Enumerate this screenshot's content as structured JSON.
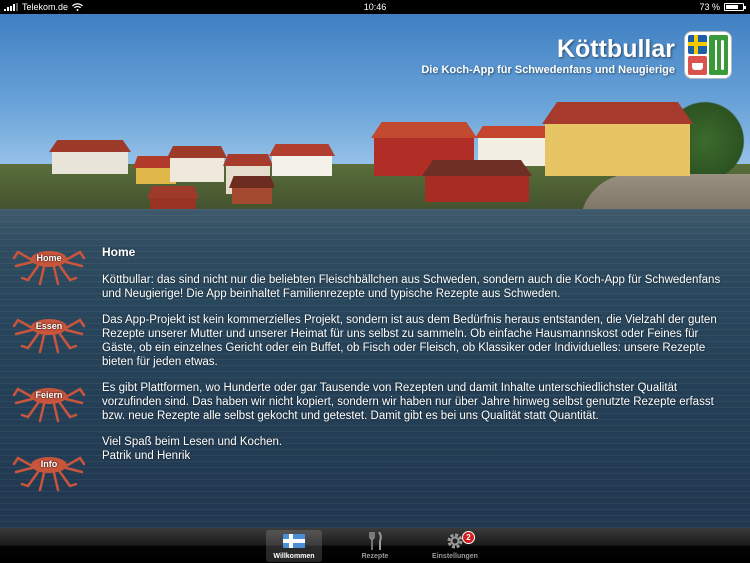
{
  "status_bar": {
    "carrier": "Telekom.de",
    "time": "10:46",
    "battery_percent": "73 %",
    "battery_level": 0.73
  },
  "header": {
    "title": "Köttbullar",
    "subtitle": "Die Koch-App für Schwedenfans und Neugierige",
    "logo_icon": "koettbullar-logo-icon"
  },
  "side_nav": {
    "items": [
      {
        "label": "Home",
        "icon": "crab-icon"
      },
      {
        "label": "Essen",
        "icon": "crab-icon"
      },
      {
        "label": "Feiern",
        "icon": "crab-icon"
      },
      {
        "label": "Info",
        "icon": "crab-icon"
      }
    ]
  },
  "content": {
    "heading": "Home",
    "paragraphs": [
      "Köttbullar: das sind nicht nur die beliebten Fleischbällchen aus Schweden, sondern auch die Koch-App für Schwedenfans und Neugierige! Die App beinhaltet Familienrezepte und typische Rezepte aus Schweden.",
      "Das App-Projekt ist kein kommerzielles Projekt, sondern ist aus dem Bedürfnis heraus entstanden, die Vielzahl der guten Rezepte unserer Mutter und unserer Heimat für uns selbst zu sammeln. Ob einfache Hausmannskost oder Feines für Gäste, ob ein einzelnes Gericht oder ein Buffet, ob Fisch oder Fleisch, ob Klassiker oder Individuelles: unsere Rezepte bieten für jeden etwas.",
      "Es gibt Plattformen, wo Hunderte oder gar Tausende von Rezepten und damit Inhalte unterschiedlichster Qualität vorzufinden sind. Das haben wir nicht kopiert, sondern wir haben nur über Jahre hinweg selbst genutzte Rezepte erfasst bzw. neue Rezepte alle selbst gekocht und getestet. Damit gibt es bei uns Qualität statt Quantität."
    ],
    "closing_line1": "Viel Spaß beim Lesen und Kochen.",
    "closing_line2": "Patrik und Henrik"
  },
  "tab_bar": {
    "tabs": [
      {
        "label": "Willkommen",
        "icon": "swedish-flag-icon",
        "active": true
      },
      {
        "label": "Rezepte",
        "icon": "fork-knife-icon",
        "active": false
      },
      {
        "label": "Einstellungen",
        "icon": "gear-icon",
        "active": false,
        "badge": "2"
      }
    ]
  },
  "colors": {
    "badge": "#d21e1e",
    "flag_blue": "#1b5fa8",
    "flag_yellow": "#f6c800",
    "crab": "#c8553c"
  }
}
